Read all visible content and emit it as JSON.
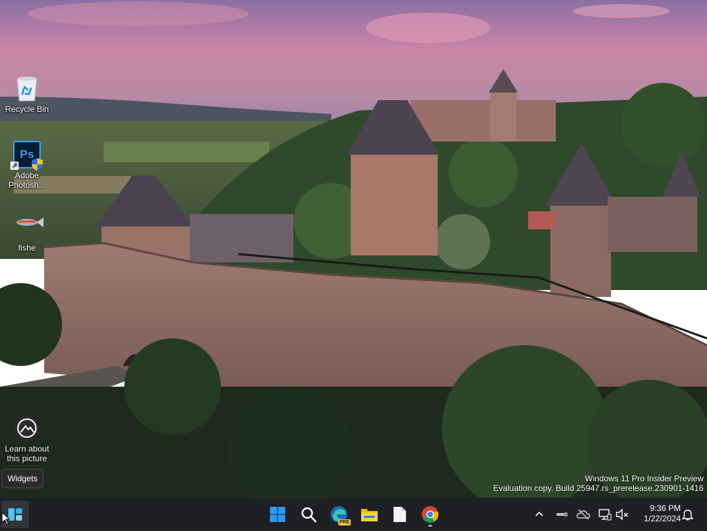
{
  "desktop": {
    "icons": [
      {
        "label": "Recycle Bin",
        "icon": "recycle-bin-icon"
      },
      {
        "label": "Adobe\nPhotosh...",
        "icon": "photoshop-icon",
        "glyph_text": "Ps"
      },
      {
        "label": "fishe",
        "icon": "fish-icon"
      },
      {
        "label": "Learn about\nthis picture",
        "icon": "camera-lens-icon"
      }
    ],
    "watermark": {
      "line1": "Windows 11 Pro Insider Preview",
      "line2": "Evaluation copy. Build 25947.rs_prerelease.230901-1416"
    },
    "widgets_tooltip": "Widgets"
  },
  "taskbar": {
    "apps": [
      {
        "name": "Start",
        "icon": "windows-logo-icon"
      },
      {
        "name": "Search",
        "icon": "search-icon"
      },
      {
        "name": "Microsoft Edge Preview",
        "icon": "edge-pre-icon",
        "badge": "PRE"
      },
      {
        "name": "File Explorer",
        "icon": "folder-icon"
      },
      {
        "name": "Notepad",
        "icon": "document-icon"
      },
      {
        "name": "Google Chrome",
        "icon": "chrome-icon"
      }
    ],
    "tray": {
      "icons": [
        "chevron-up-icon",
        "usb-icon",
        "onedrive-offline-icon",
        "network-icon",
        "speaker-muted-icon",
        "notifications-bell-icon"
      ],
      "time": "9:36 PM",
      "date": "1/22/2024"
    }
  },
  "colors": {
    "taskbar_bg": "#1f2024",
    "sky_top": "#7d6aa8",
    "sky_pink": "#d88aa6",
    "wall": "#8c6b63"
  }
}
